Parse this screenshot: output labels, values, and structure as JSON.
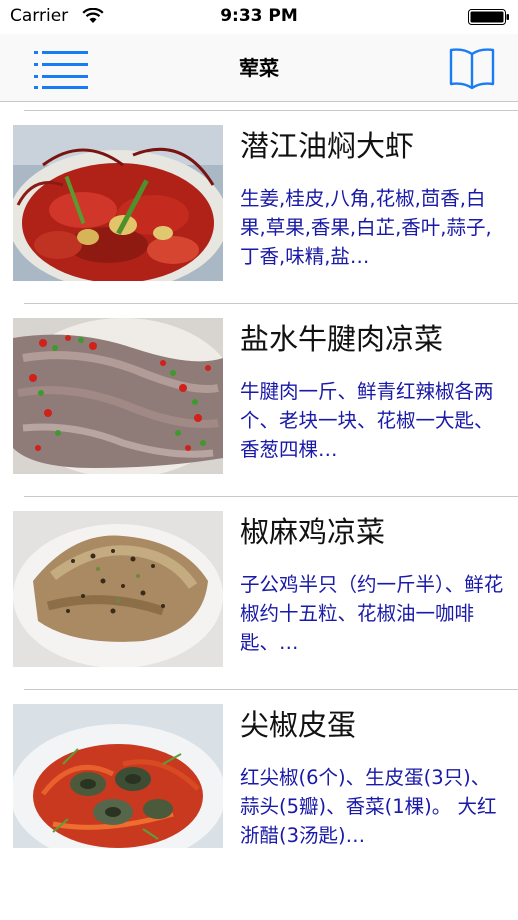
{
  "status_bar": {
    "carrier": "Carrier",
    "time": "9:33 PM"
  },
  "nav": {
    "title": "荤菜",
    "left_icon": "list-menu-icon",
    "right_icon": "book-icon",
    "accent_color": "#1a7cf5"
  },
  "recipes": [
    {
      "title": "潜江油焖大虾",
      "ingredients": "生姜,桂皮,八角,花椒,茴香,白果,草果,香果,白芷,香叶,蒜子,丁香,味精,盐…"
    },
    {
      "title": "盐水牛腱肉凉菜",
      "ingredients": "牛腱肉一斤、鲜青红辣椒各两个、老块一块、花椒一大匙、香葱四棵…"
    },
    {
      "title": "椒麻鸡凉菜",
      "ingredients": "子公鸡半只（约一斤半）、鲜花椒约十五粒、花椒油一咖啡匙、…"
    },
    {
      "title": "尖椒皮蛋",
      "ingredients": "红尖椒(6个)、生皮蛋(3只)、蒜头(5瓣)、香菜(1棵)。 大红浙醋(3汤匙)…"
    }
  ]
}
